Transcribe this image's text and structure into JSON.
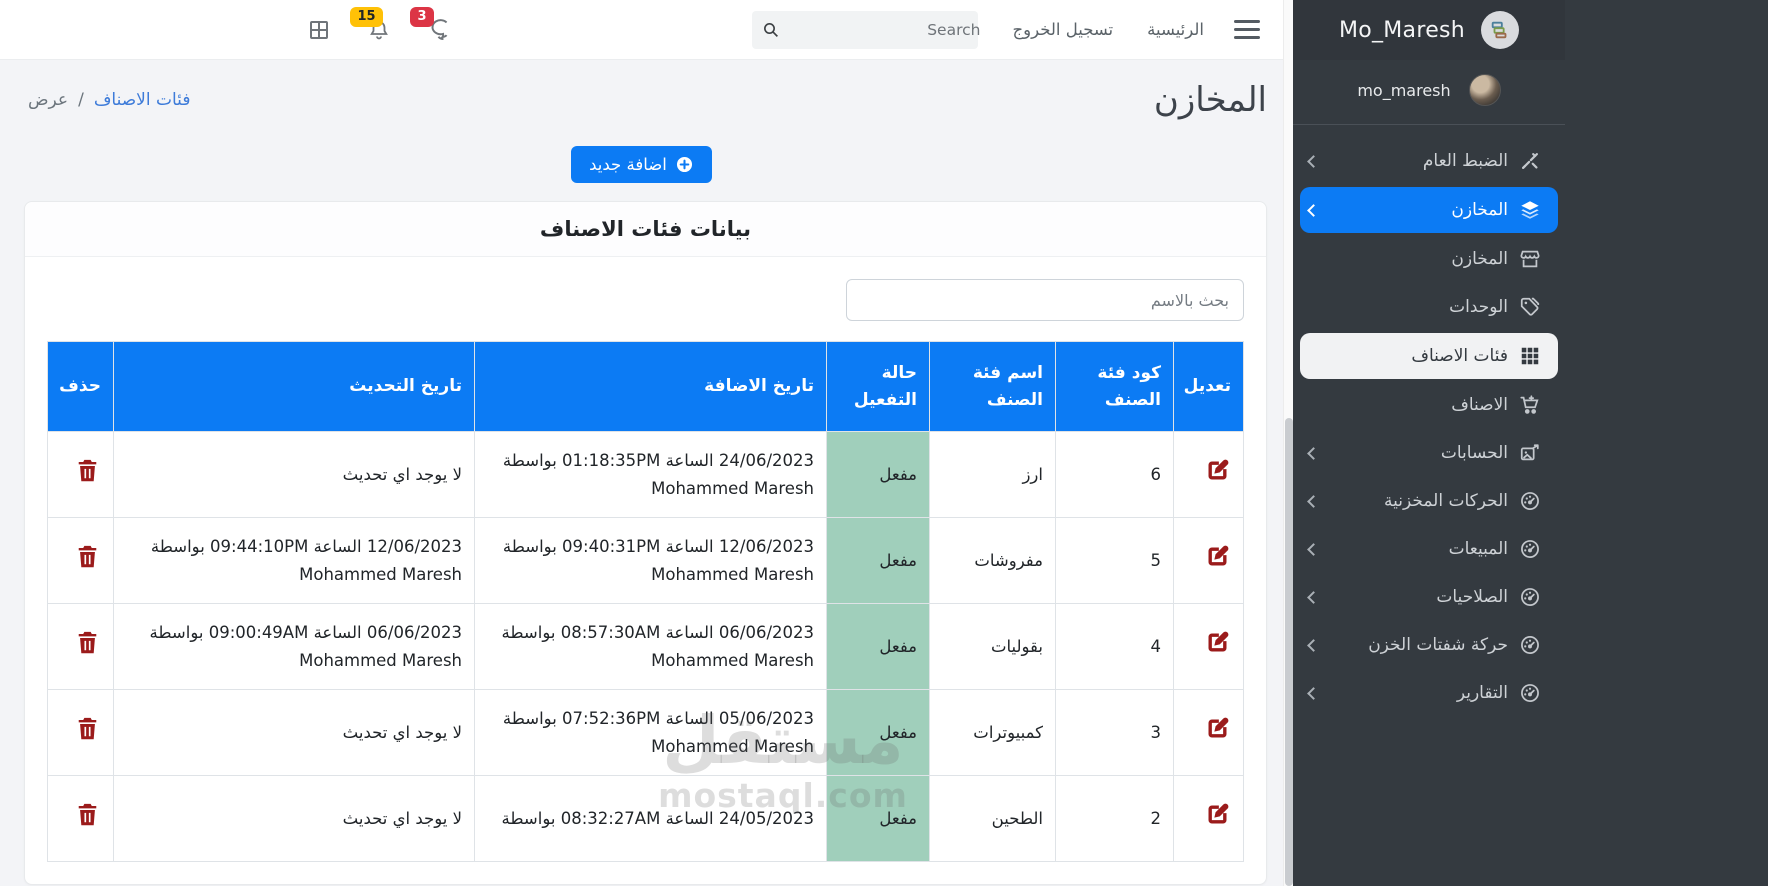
{
  "navbar": {
    "search_placeholder": "Search",
    "logout_label": "تسجيل الخروج",
    "home_label": "الرئيسية",
    "notifications_count": "15",
    "messages_count": "3"
  },
  "sidebar": {
    "brand": "Mo_Maresh",
    "username": "mo_maresh",
    "items": [
      {
        "label": "الضبط العام",
        "icon": "tools",
        "chevron": true
      },
      {
        "label": "المخازن",
        "icon": "layers",
        "chevron": true,
        "active": true
      },
      {
        "label": "المخازن",
        "icon": "store",
        "sub": true
      },
      {
        "label": "الوحدات",
        "icon": "tags",
        "sub": true
      },
      {
        "label": "فئات الاصناف",
        "icon": "grid",
        "sub": true,
        "active_sub": true
      },
      {
        "label": "الاصناف",
        "icon": "cart",
        "sub": true
      },
      {
        "label": "الحسابات",
        "icon": "accounts",
        "chevron": true
      },
      {
        "label": "الحركات المخزنية",
        "icon": "gauge",
        "chevron": true
      },
      {
        "label": "المبيعات",
        "icon": "gauge",
        "chevron": true
      },
      {
        "label": "الصلاحيات",
        "icon": "gauge",
        "chevron": true
      },
      {
        "label": "حركة شفتات الخزن",
        "icon": "gauge",
        "chevron": true
      },
      {
        "label": "التقارير",
        "icon": "gauge",
        "chevron": true
      }
    ]
  },
  "page": {
    "title": "المخازن",
    "breadcrumb": {
      "link": "فئات الاصناف",
      "separator": "/",
      "current": "عرض"
    },
    "add_button_label": "اضافة جديد"
  },
  "card": {
    "title": "بيانات فئات الاصناف",
    "search_placeholder": "بحث بالاسم"
  },
  "table": {
    "headers": [
      "تعديل",
      "كود فئة الصنف",
      "اسم فئة الصنف",
      "حالة التفعيل",
      "تاريخ الاضافة",
      "تاريخ التحديث",
      "حذف"
    ],
    "rows": [
      {
        "code": "6",
        "name": "ارز",
        "status": "مفعل",
        "added": "24/06/2023 الساعة 01:18:35PM بواسطة",
        "added_by": "Mohammed Maresh",
        "updated": "لا يوجد اي تحديث",
        "updated_by": ""
      },
      {
        "code": "5",
        "name": "مفروشات",
        "status": "مفعل",
        "added": "12/06/2023 الساعة 09:40:31PM بواسطة",
        "added_by": "Mohammed Maresh",
        "updated": "12/06/2023 الساعة 09:44:10PM بواسطة",
        "updated_by": "Mohammed Maresh"
      },
      {
        "code": "4",
        "name": "بقوليات",
        "status": "مفعل",
        "added": "06/06/2023 الساعة 08:57:30AM بواسطة",
        "added_by": "Mohammed Maresh",
        "updated": "06/06/2023 الساعة 09:00:49AM بواسطة",
        "updated_by": "Mohammed Maresh"
      },
      {
        "code": "3",
        "name": "كمبيوترات",
        "status": "مفعل",
        "added": "05/06/2023 الساعة 07:52:36PM بواسطة",
        "added_by": "Mohammed Maresh",
        "updated": "لا يوجد اي تحديث",
        "updated_by": ""
      },
      {
        "code": "2",
        "name": "الطحين",
        "status": "مفعل",
        "added": "24/05/2023 الساعة 08:32:27AM بواسطة",
        "added_by": "",
        "updated": "لا يوجد اي تحديث",
        "updated_by": ""
      }
    ]
  },
  "watermark": {
    "line1": "مستقل",
    "line2": "mostaql.com"
  },
  "colors": {
    "primary": "#0c7bf4",
    "sidebar_bg": "#343a40",
    "status_active_bg": "#a0cfbb",
    "warning_badge": "#ffc107",
    "danger_badge": "#dc3545",
    "action_icon_red": "#9b1b1b"
  }
}
